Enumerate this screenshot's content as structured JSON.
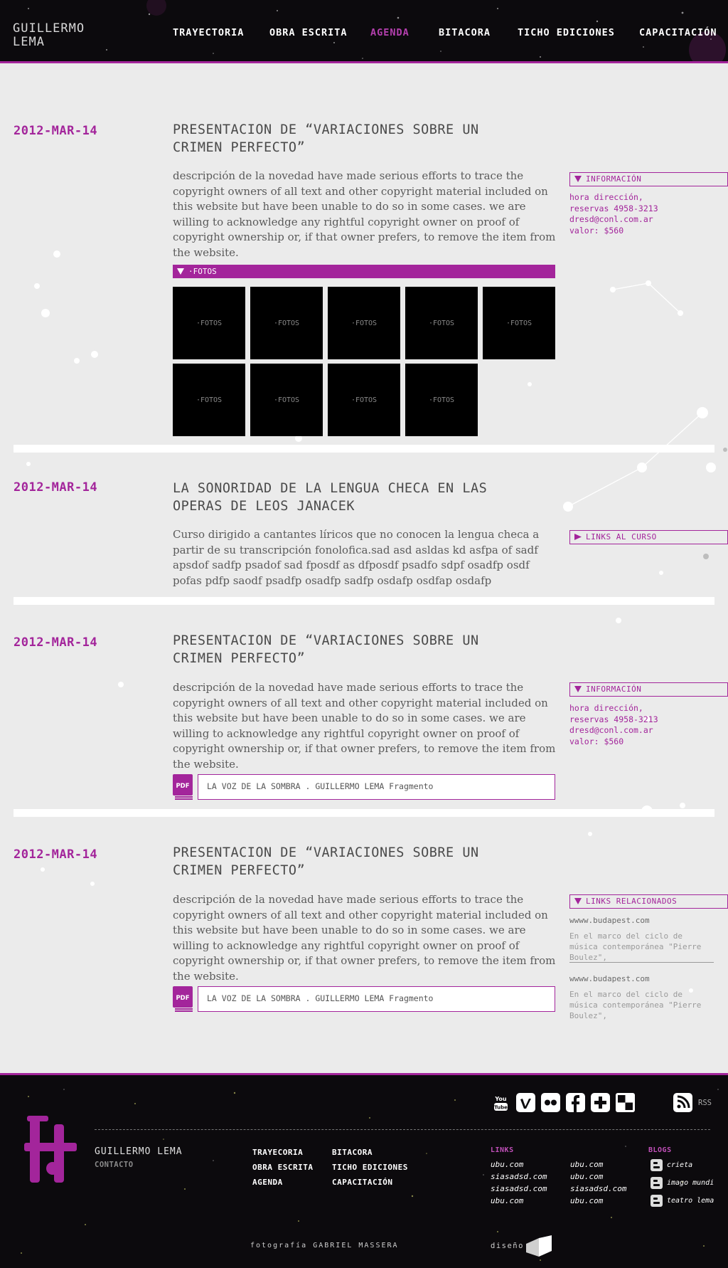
{
  "header": {
    "logo": "GUILLERMO LEMA",
    "nav": [
      "TRAYECTORIA",
      "OBRA ESCRITA",
      "AGENDA",
      "BITACORA",
      "TICHO EDICIONES",
      "CAPACITACIÓN"
    ],
    "active": "AGENDA"
  },
  "entries": [
    {
      "date": "2012-MAR-14",
      "title": "PRESENTACION DE “VARIACIONES SOBRE UN CRIMEN PERFECTO”",
      "desc": "descripción de la novedad have made serious efforts to trace the copyright owners of all text and other copyright material included on this website but have been unable to do so in some cases. we are willing to acknowledge any rightful copyright owner on proof of copyright ownership or, if that owner prefers, to remove the item from the website.",
      "side_header": "INFORMACIÓN",
      "side_info": [
        "hora dirección,",
        "reservas 4958-3213",
        "dresd@conl.com.ar",
        "valor: $560"
      ],
      "fotos_label": "·FOTOS",
      "thumbs": [
        "·FOTOS",
        "·FOTOS",
        "·FOTOS",
        "·FOTOS",
        "·FOTOS",
        "·FOTOS",
        "·FOTOS",
        "·FOTOS",
        "·FOTOS"
      ]
    },
    {
      "date": "2012-MAR-14",
      "title": "LA SONORIDAD DE LA LENGUA CHECA EN LAS OPERAS DE LEOS JANACEK",
      "desc": "Curso dirigido a cantantes líricos que no conocen la lengua checa a partir de su transcripción fonolofica.sad  asd asldas kd asfpa of sadf apsdof sadfp psadof sad fposdf as dfposdf psadfo sdpf osadfp osdf pofas pdfp saodf psadfp osadfp sadfp osdafp osdfap osdafp",
      "side_header": "LINKS AL CURSO"
    },
    {
      "date": "2012-MAR-14",
      "title": "PRESENTACION DE “VARIACIONES SOBRE UN CRIMEN PERFECTO”",
      "desc": "descripción de la novedad have made serious efforts to trace the copyright owners of all text and other copyright material included on this website but have been unable to do so in some cases. we are willing to acknowledge any rightful copyright owner on proof of copyright ownership or, if that owner prefers, to remove the item from the website.",
      "side_header": "INFORMACIÓN",
      "side_info": [
        "hora dirección,",
        "reservas 4958-3213",
        "dresd@conl.com.ar",
        "valor: $560"
      ],
      "pdf_label": "PDF",
      "pdf_text": "LA VOZ DE LA SOMBRA . GUILLERMO LEMA Fragmento"
    },
    {
      "date": "2012-MAR-14",
      "title": "PRESENTACION DE “VARIACIONES SOBRE UN CRIMEN PERFECTO”",
      "desc": "descripción de la novedad have made serious efforts to trace the copyright owners of all text and other copyright material included on this website but have been unable to do so in some cases. we are willing to acknowledge any rightful copyright owner on proof of copyright ownership or, if that owner prefers, to remove the item from the website.",
      "side_header": "LINKS RELACIONADOS",
      "related": [
        {
          "url": "wwww.budapest.com",
          "text": "En el marco del ciclo de música contemporánea \"Pierre Boulez\","
        },
        {
          "url": "wwww.budapest.com",
          "text": "En el marco del ciclo de música contemporánea \"Pierre Boulez\","
        }
      ],
      "pdf_label": "PDF",
      "pdf_text": "LA VOZ DE LA SOMBRA . GUILLERMO LEMA Fragmento"
    }
  ],
  "footer": {
    "name": "GUILLERMO LEMA",
    "contact": "CONTACTO",
    "nav_col1": [
      "TRAYECORIA",
      "OBRA ESCRITA",
      "AGENDA"
    ],
    "nav_col2": [
      "BITACORA",
      "TICHO EDICIONES",
      "CAPACITACIÓN"
    ],
    "links_head": "LINKS",
    "links_col1": [
      "ubu.com",
      "siasadsd.com",
      "siasadsd.com",
      "ubu.com"
    ],
    "links_col2": [
      "ubu.com",
      "ubu.com",
      "siasadsd.com",
      "ubu.com"
    ],
    "blogs_head": "BLOGS",
    "blogs": [
      "crieta",
      "imago mundi",
      "teatro lema"
    ],
    "social_icons": [
      "youtube-icon",
      "vimeo-icon",
      "flickr-icon",
      "facebook-icon",
      "plus-icon",
      "delicious-icon",
      "rss-icon"
    ],
    "youtube_label": "You Tube",
    "rss_label": "RSS",
    "photo_credit": "fotografía GABRIEL MASSERA",
    "design_label": "diseño"
  },
  "colors": {
    "accent": "#a3259b",
    "background": "#ebebeb",
    "dark": "#0c0a0d"
  }
}
